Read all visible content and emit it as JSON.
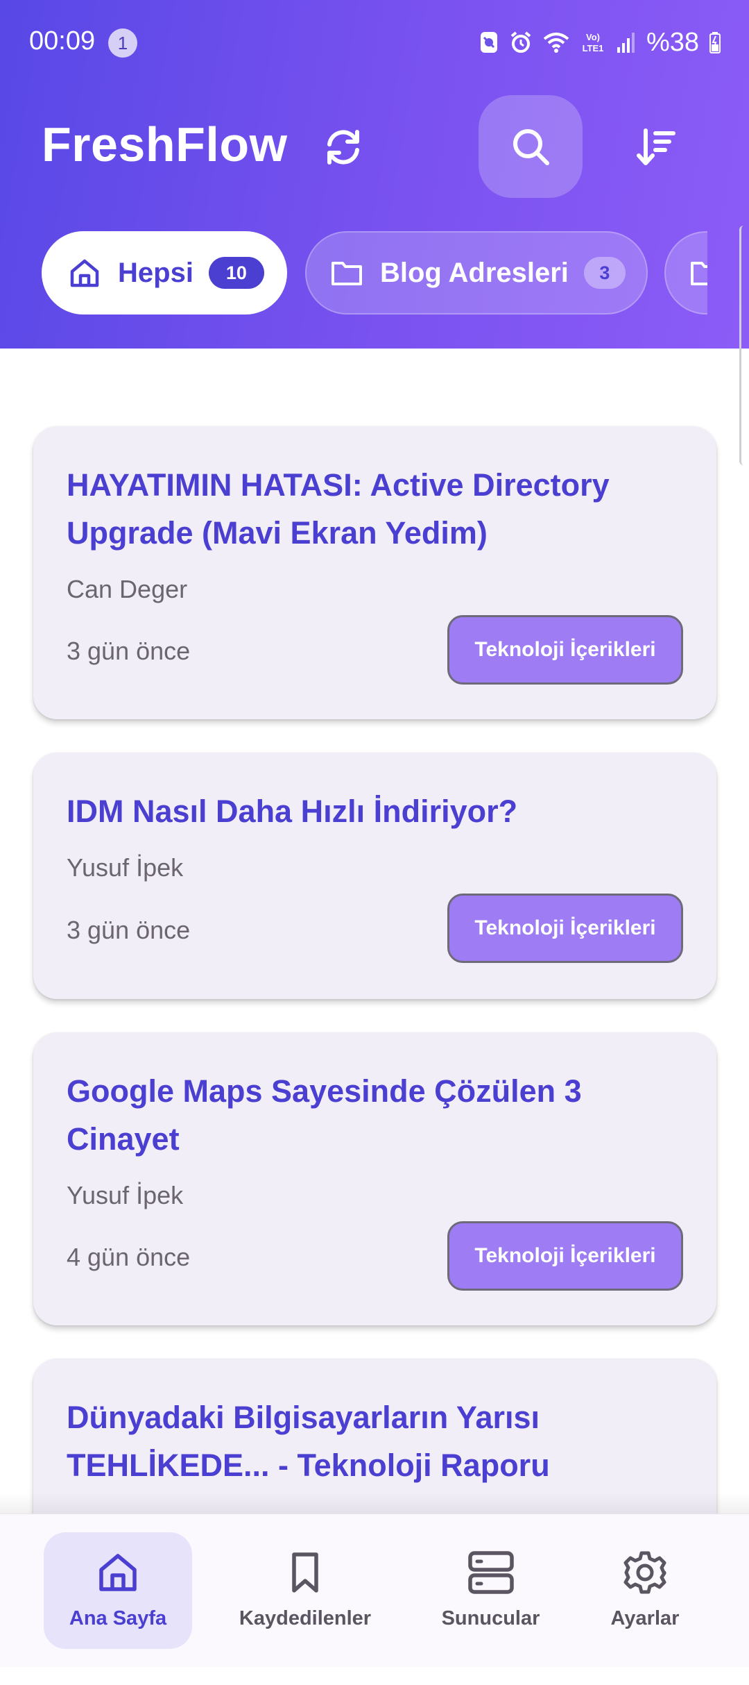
{
  "status_bar": {
    "time": "00:09",
    "notification_count": "1",
    "battery": "%38",
    "icons": [
      "silent-mode-icon",
      "alarm-icon",
      "wifi-icon",
      "volte-icon",
      "signal-icon",
      "battery-icon"
    ]
  },
  "header": {
    "title": "FreshFlow",
    "actions": [
      "refresh-icon",
      "search-icon",
      "sort-icon"
    ]
  },
  "categories": [
    {
      "label": "Hepsi",
      "count": "10",
      "icon": "home-icon",
      "selected": true
    },
    {
      "label": "Blog Adresleri",
      "count": "3",
      "icon": "folder-icon",
      "selected": false
    },
    {
      "label": "",
      "count": "",
      "icon": "folder-icon",
      "selected": false
    }
  ],
  "articles": [
    {
      "title": "HAYATIMIN HATASI: Active Directory Upgrade (Mavi Ekran Yedim)",
      "author": "Can Deger",
      "time": "3 gün önce",
      "tag": "Teknoloji İçerikleri"
    },
    {
      "title": "IDM Nasıl Daha Hızlı İndiriyor?",
      "author": "Yusuf İpek",
      "time": "3 gün önce",
      "tag": "Teknoloji İçerikleri"
    },
    {
      "title": "Google Maps Sayesinde Çözülen 3 Cinayet",
      "author": "Yusuf İpek",
      "time": "4 gün önce",
      "tag": "Teknoloji İçerikleri"
    },
    {
      "title": "Dünyadaki Bilgisayarların Yarısı TEHLİKEDE... - Teknoloji Raporu",
      "author": "",
      "time": "",
      "tag": ""
    }
  ],
  "bottom_nav": [
    {
      "label": "Ana Sayfa",
      "icon": "home-icon",
      "active": true
    },
    {
      "label": "Kaydedilenler",
      "icon": "bookmark-icon",
      "active": false
    },
    {
      "label": "Sunucular",
      "icon": "server-icon",
      "active": false
    },
    {
      "label": "Ayarlar",
      "icon": "gear-icon",
      "active": false
    }
  ],
  "colors": {
    "header_gradient_start": "#5848e6",
    "header_gradient_end": "#8c5cf7",
    "accent": "#4a3fd0",
    "tag_background": "#9d7cf4",
    "card_background": "#f2eef8"
  }
}
